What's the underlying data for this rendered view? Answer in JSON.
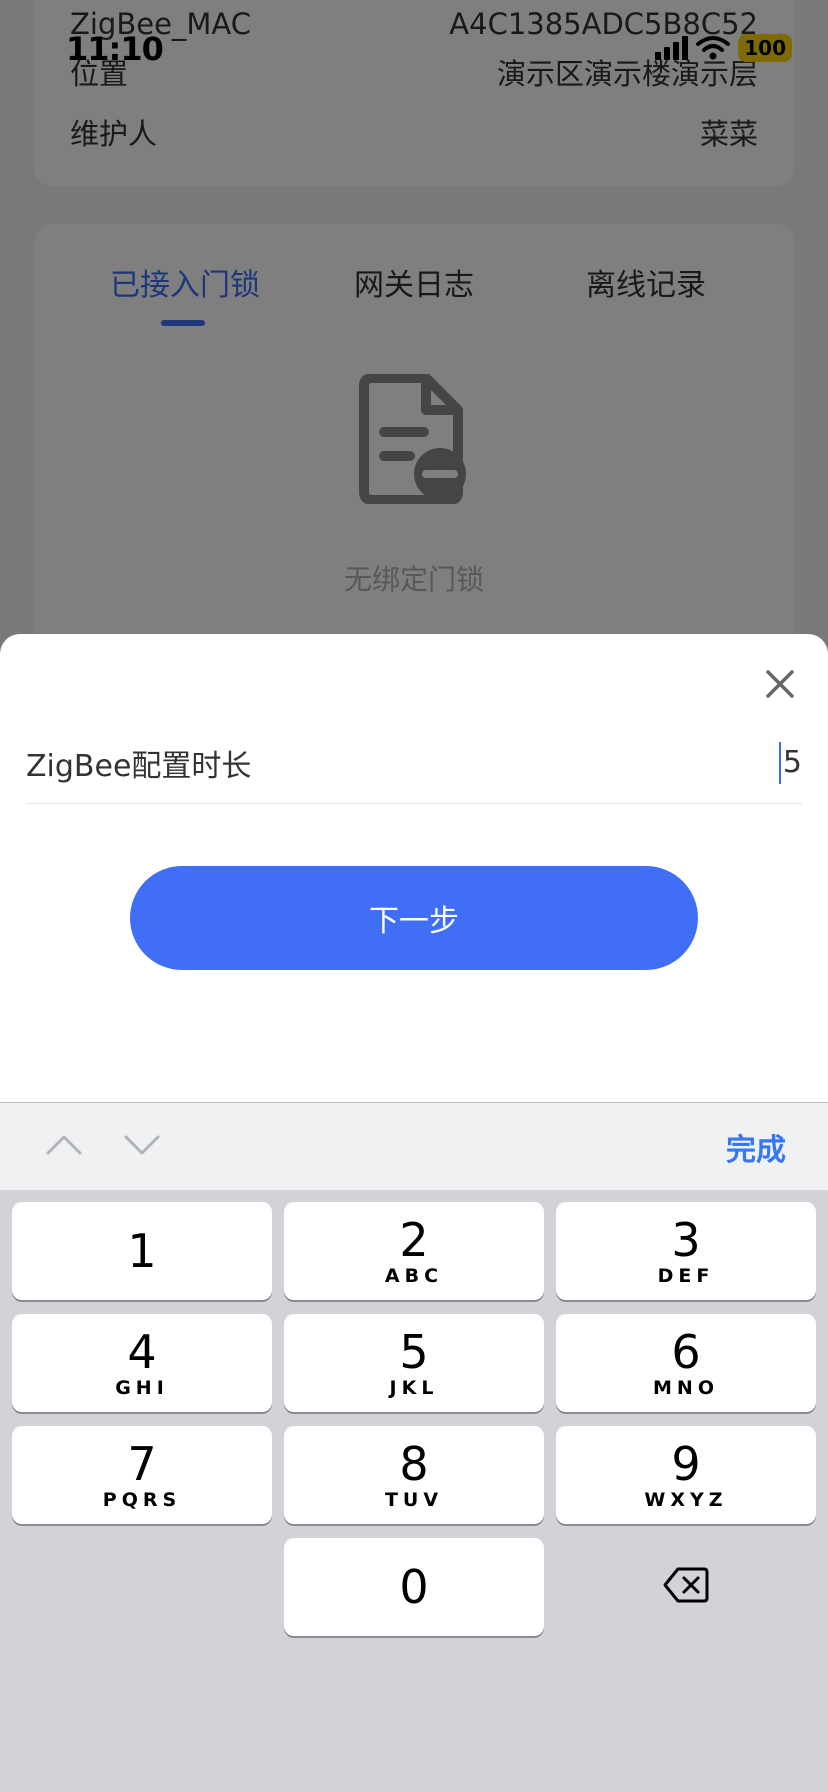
{
  "status_bar": {
    "time": "11:10",
    "battery": "100"
  },
  "gateway_info": {
    "rows": [
      {
        "label": "ZigBee_MAC",
        "value": "A4C1385ADC5B8C52"
      },
      {
        "label": "位置",
        "value": "演示区演示楼演示层"
      },
      {
        "label": "维护人",
        "value": "菜菜"
      }
    ]
  },
  "tabs": {
    "items": [
      {
        "label": "已接入门锁",
        "active": true
      },
      {
        "label": "网关日志",
        "active": false
      },
      {
        "label": "离线记录",
        "active": false
      }
    ],
    "empty_text": "无绑定门锁"
  },
  "sheet": {
    "field_label": "ZigBee配置时长",
    "field_value": "5",
    "next_label": "下一步"
  },
  "keyboard": {
    "done_label": "完成",
    "keys": [
      {
        "num": "1",
        "letters": ""
      },
      {
        "num": "2",
        "letters": "ABC"
      },
      {
        "num": "3",
        "letters": "DEF"
      },
      {
        "num": "4",
        "letters": "GHI"
      },
      {
        "num": "5",
        "letters": "JKL"
      },
      {
        "num": "6",
        "letters": "MNO"
      },
      {
        "num": "7",
        "letters": "PQRS"
      },
      {
        "num": "8",
        "letters": "TUV"
      },
      {
        "num": "9",
        "letters": "WXYZ"
      },
      {
        "num": "0",
        "letters": ""
      }
    ]
  },
  "colors": {
    "accent": "#406ef5",
    "tab_active": "#3d6df5",
    "done": "#3478f6",
    "keyboard_bg": "#d1d3d9"
  }
}
